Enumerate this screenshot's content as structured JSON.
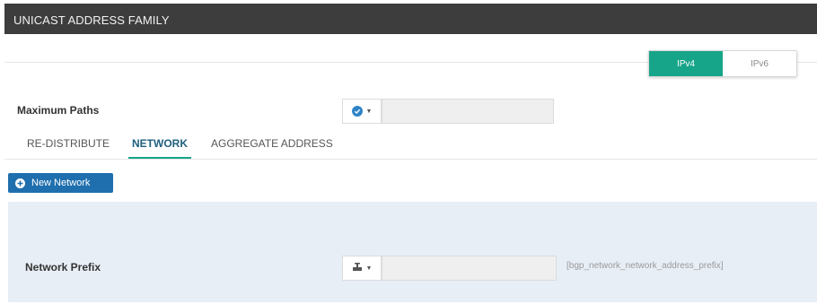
{
  "header": {
    "title": "UNICAST ADDRESS FAMILY"
  },
  "address_family_toggle": {
    "options": [
      {
        "label": "IPv4",
        "active": true
      },
      {
        "label": "IPv6",
        "active": false
      }
    ],
    "active_color": "#17a589"
  },
  "maximum_paths": {
    "label": "Maximum Paths",
    "mode_icon": "check-circle-icon",
    "value": ""
  },
  "tabs": [
    {
      "label": "RE-DISTRIBUTE",
      "active": false
    },
    {
      "label": "NETWORK",
      "active": true
    },
    {
      "label": "AGGREGATE ADDRESS",
      "active": false
    }
  ],
  "new_network_button": {
    "label": "New Network",
    "icon": "plus-circle-icon",
    "color": "#1f6fae"
  },
  "network_prefix": {
    "label": "Network Prefix",
    "mode_icon": "network-icon",
    "value": "",
    "hint": "[bgp_network_network_address_prefix]"
  }
}
